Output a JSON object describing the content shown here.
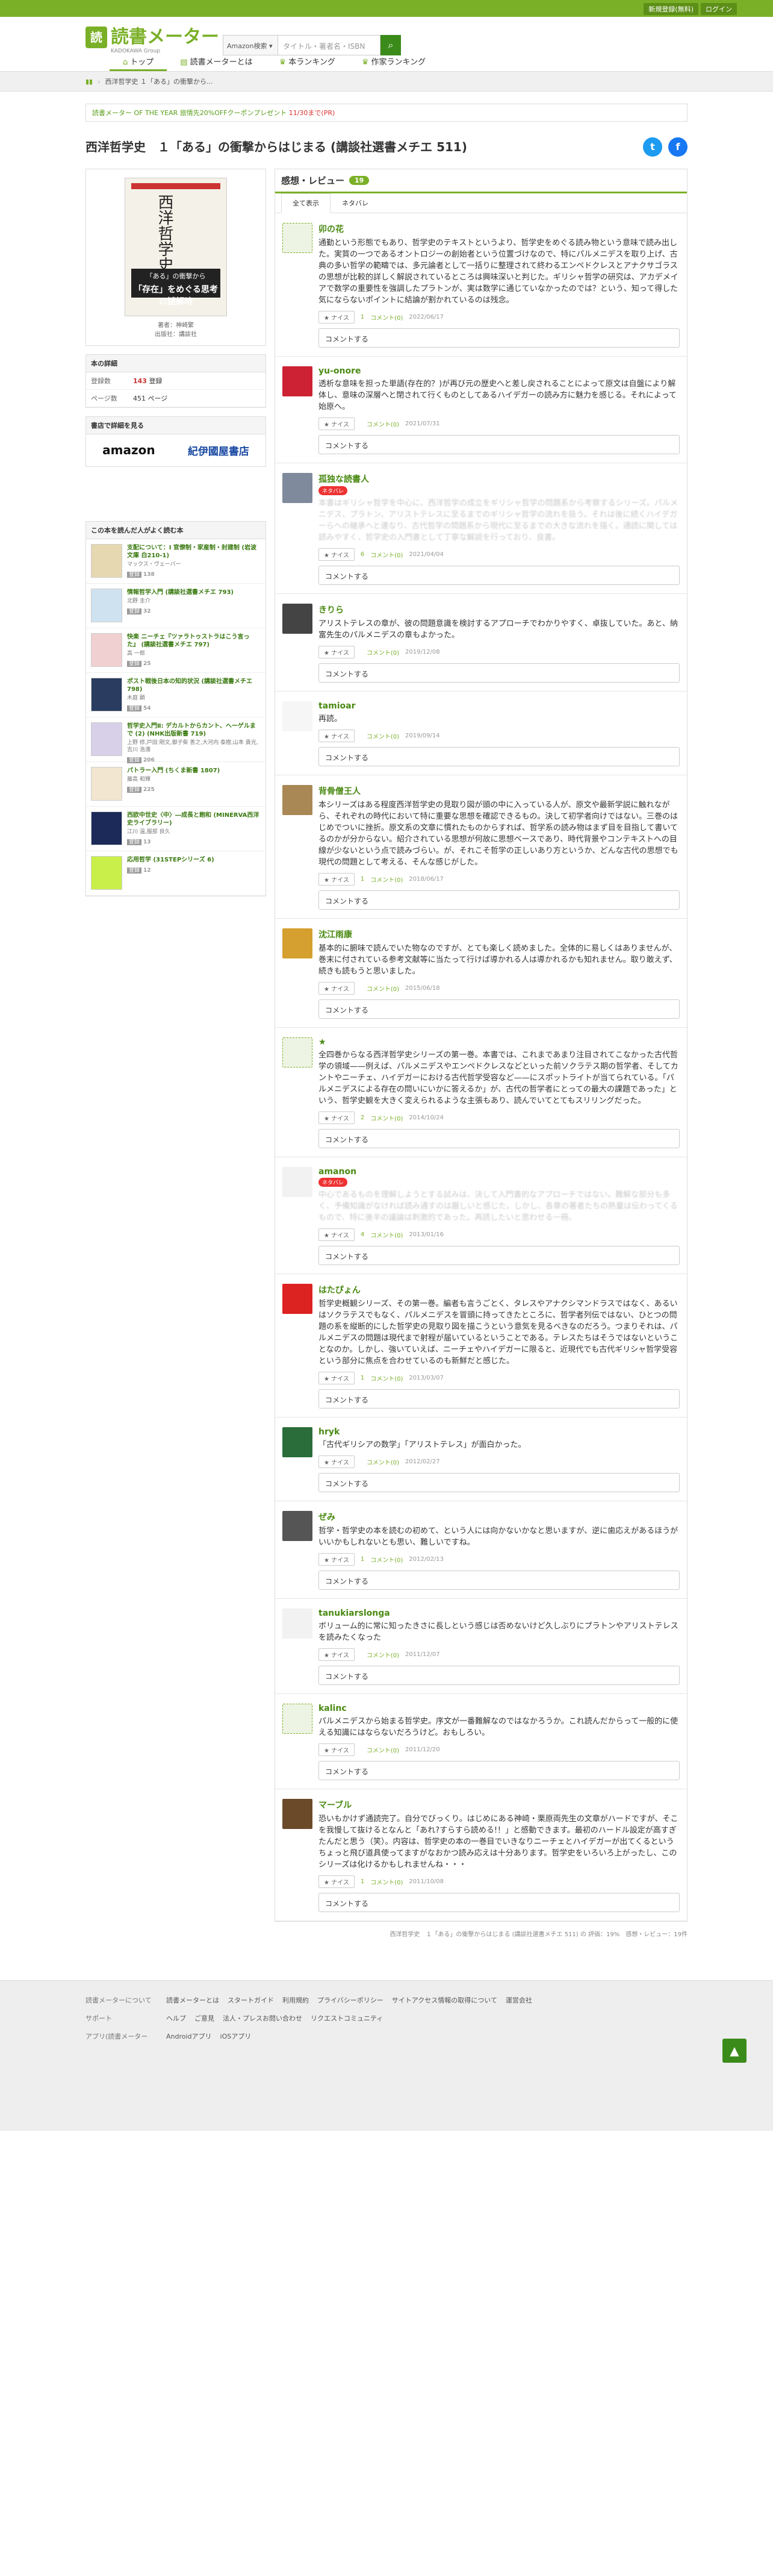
{
  "topbar": {
    "signup": "新規登録(無料)",
    "login": "ログイン"
  },
  "logo": {
    "mark": "読",
    "title": "読書メーター",
    "sub": "KADOKAWA Group"
  },
  "search": {
    "select": "Amazon検索 ▾",
    "placeholder": "タイトル・著者名・ISBN",
    "icon": "search-icon"
  },
  "nav": [
    {
      "icon": "home-icon",
      "label": "トップ"
    },
    {
      "icon": "book-icon",
      "label": "読書メーターとは"
    },
    {
      "icon": "ranking-icon",
      "label": "本ランキング"
    },
    {
      "icon": "author-icon",
      "label": "作家ランキング"
    }
  ],
  "breadcrumb": [
    "西洋哲学史 １「ある」の衝撃から..."
  ],
  "notice": {
    "a": "読書メーター OF THE YEAR",
    "b": "旅情先20%OFFクーポンプレゼント",
    "c": "11/30まで(PR)"
  },
  "title": "西洋哲学史　１「ある」の衝撃からはじまる (講談社選書メチエ 511)",
  "share": {
    "tw": "t",
    "fb": "f"
  },
  "book": {
    "cover_title": "西洋哲学史Ⅰ",
    "band_top": "「ある」の衝撃から",
    "band_main": "「存在」をめぐる思考の謎解時",
    "author": "著者：神崎繁",
    "publisher": "出版社：講談社"
  },
  "details": {
    "header": "本の詳細",
    "rows": [
      {
        "k": "登録数",
        "v": "143",
        "u": "登録"
      },
      {
        "k": "ページ数",
        "v": "451",
        "u": "ページ"
      }
    ]
  },
  "buy": {
    "header": "書店で詳細を見る",
    "amazon": "amazon",
    "kino": "紀伊國屋書店"
  },
  "alsoread": {
    "header": "この本を読んだ人がよく読む本",
    "items": [
      {
        "t": "支配について：Ⅰ 官僚制・家産制・封建制 (岩波文庫 白210-1)",
        "a": "マックス・ヴェーバー",
        "c": "138"
      },
      {
        "t": "情報哲学入門 (講談社選書メチエ 793)",
        "a": "北野 圭介",
        "c": "32"
      },
      {
        "t": "快楽 ニーチェ『ツァラトゥストラはこう言った』 (講談社選書メチエ 797)",
        "a": "高 一郎",
        "c": "25"
      },
      {
        "t": "ポスト戦後日本の知的状況 (講談社選書メチエ 798)",
        "a": "木庭 顕",
        "c": "54"
      },
      {
        "t": "哲学史入門Ⅱ: デカルトからカント、ヘーゲルまで (2) (NHK出版新書 719)",
        "a": "上野 修,戸田 剛文,御子柴 善之,大河内 泰樹,山本 貴光,吉川 浩満",
        "c": "206"
      },
      {
        "t": "パトラー入門 (ちくま新書 1807)",
        "a": "藤高 和輝",
        "c": "225"
      },
      {
        "t": "西欧中世史〈中〉―成長と飽和 (MINERVA西洋史ライブラリー)",
        "a": "江川 溫,服部 良久",
        "c": "13"
      },
      {
        "t": "応用哲学 (31STEPシリーズ 6)",
        "a": "",
        "c": "12"
      }
    ]
  },
  "reviews_header": {
    "title": "感想・レビュー",
    "count": "19",
    "tab_all": "全て表示",
    "tab_spoiler": "ネタバレ"
  },
  "labels": {
    "nice": "★ ナイス",
    "comment_box": "コメントする",
    "spoiler": "ネタバレ"
  },
  "reviews": [
    {
      "user": "卯の花",
      "spoiler": false,
      "text": "通勤という形態でもあり、哲学史のテキストというより、哲学史をめぐる読み物という意味で読み出した。実質の一つであるオントロジーの創始者という位置づけなので、特にパルメニデスを取り上げ、古典の多い哲学の範疇では、多元論者として一括りに整理されて終わるエンペドクレスとアナクサゴラスの思想が比較的詳しく解説されているところは興味深いと判じた。ギリシャ哲学の研究は、アカデメイアで数学の重要性を強調したプラトンが、実は数学に通じていなかったのでは？という、知って得した気にならないポイントに結論が割かれているのは残念。",
      "nice": "1",
      "cmt": "コメント(0)",
      "date": "2022/06/17"
    },
    {
      "user": "yu-onore",
      "spoiler": false,
      "text": "透析な意味を担った単語(存在的？)が再び元の歴史へと差し戻されることによって原文は自盤により解体し、意味の深層へと閉されて行くものとしてあるハイデガーの読み方に魅力を感じる。それによって始原へ。",
      "nice": "",
      "cmt": "コメント(0)",
      "date": "2021/07/31"
    },
    {
      "user": "孤独な読書人",
      "spoiler": true,
      "text": "本書はギリシャ哲学を中心に、西洋哲学の成立をギリシャ哲学の問題系から考察するシリーズ。パルメニデス、プラトン、アリストテレスに至るまでのギリシャ哲学の流れを扱う。それは後に続くハイデガーらへの継承へと連なり、古代哲学の問題系から現代に至るまでの大きな流れを描く。通読に関しては読みやすく、哲学史の入門書として丁寧な解説を行っており、良書。",
      "nice": "6",
      "cmt": "コメント(0)",
      "date": "2021/04/04"
    },
    {
      "user": "きりら",
      "spoiler": false,
      "text": "アリストテレスの章が、彼の問題意識を検討するアプローチでわかりやすく、卓抜していた。あと、納富先生のパルメニデスの章もよかった。",
      "nice": "",
      "cmt": "コメント(0)",
      "date": "2019/12/08"
    },
    {
      "user": "tamioar",
      "spoiler": false,
      "text": "再読。",
      "nice": "",
      "cmt": "コメント(0)",
      "date": "2019/09/14"
    },
    {
      "user": "背骨僧王人",
      "spoiler": false,
      "text": "本シリーズはある程度西洋哲学史の見取り図が頭の中に入っている人が、原文や最新学説に触れながら、それぞれの時代において特に重要な思想を確認できるもの。決して初学者向けではない。三巻のはじめでついに挫折。原文系の文章に慣れたものからすれば、哲学系の読み物はまず目を目指して書いてるのかが分からない。紹介されている思想が何故に思想ベースであり、時代背景やコンテキストへの目線が少ないという点で読みづらい。が、それこそ哲学の正しいあり方というか、どんな古代の思想でも現代の問題として考える、そんな感じがした。",
      "nice": "1",
      "cmt": "コメント(0)",
      "date": "2018/06/17"
    },
    {
      "user": "沈江雨康",
      "spoiler": false,
      "text": "基本的に腑味で読んでいた物なのですが、とても楽しく読めました。全体的に易しくはありませんが、巻末に付されている参考文献等に当たって行けば導かれる人は導かれるかも知れません。取り敢えず、続きも読もうと思いました。",
      "nice": "",
      "cmt": "コメント(0)",
      "date": "2015/06/18"
    },
    {
      "user": "★",
      "spoiler": false,
      "text": "全四巻からなる西洋哲学史シリーズの第一巻。本書では、これまであまり注目されてこなかった古代哲学の領域——例えば、パルメニデスやエンペドクレスなどといった前ソクラテス期の哲学者、そしてカントやニーチェ、ハイデガーにおける古代哲学受容など——にスポットライトが当てられている。「パルメニデスによる存在の問いにいかに答えるか」が、古代の哲学者にとっての最大の課題であった」という、哲学史観を大きく変えられるような主張もあり、読んでいてとてもスリリングだった。",
      "nice": "2",
      "cmt": "コメント(0)",
      "date": "2014/10/24"
    },
    {
      "user": "amanon",
      "spoiler": true,
      "text": "中心であるものを理解しようとする試みは、決して入門書的なアプローチではない。難解な部分も多く、予備知識がなければ読み通すのは厳しいと感じた。しかし、各章の著者たちの熱量は伝わってくるもので、特に後半の議論は刺激的であった。再読したいと思わせる一冊。",
      "nice": "4",
      "cmt": "コメント(0)",
      "date": "2013/01/16"
    },
    {
      "user": "はたぴょん",
      "spoiler": false,
      "text": "哲学史概観シリーズ、その第一巻。編者も言うごとく、タレスやアナクシマンドラスではなく、あるいはソクラテスでもなく、パルメニデスを冒頭に持ってきたところに、哲学者列伝ではない、ひとつの問題の系を縦断的にした哲学史の見取り図を描こうという意気を見るべきなのだろう。つまりそれは、パルメニデスの問題は現代まで射程が届いているということである。テレスたちはそうではないということなのか。しかし、強いていえば、ニーチェやハイデガーに限ると、近現代でも古代ギリシャ哲学受容という部分に焦点を合わせているのも新鮮だと感じた。",
      "nice": "1",
      "cmt": "コメント(0)",
      "date": "2013/03/07"
    },
    {
      "user": "hryk",
      "spoiler": false,
      "text": "「古代ギリシアの数学」「アリストテレス」が面白かった。",
      "nice": "",
      "cmt": "コメント(0)",
      "date": "2012/02/27"
    },
    {
      "user": "ぜみ",
      "spoiler": false,
      "text": "哲学・哲学史の本を読むの初めて、という人には向かないかなと思いますが、逆に歯応えがあるほうがいいかもしれないとも思い、難しいですね。",
      "nice": "1",
      "cmt": "コメント(0)",
      "date": "2012/02/13"
    },
    {
      "user": "tanukiarslonga",
      "spoiler": false,
      "text": "ボリューム的に常に知ったきさに長しという感じは否めないけど久しぶりにプラトンやアリストテレスを読みたくなった",
      "nice": "",
      "cmt": "コメント(0)",
      "date": "2011/12/07"
    },
    {
      "user": "kalinc",
      "spoiler": false,
      "text": "パルメニデスから始まる哲学史。序文が一番難解なのではなかろうか。これ読んだからって一般的に使える知識にはならないだろうけど。おもしろい。",
      "nice": "",
      "cmt": "コメント(0)",
      "date": "2011/12/20"
    },
    {
      "user": "マーブル",
      "spoiler": false,
      "text": "恐いもかけず通読完了。自分でびっくり。はじめにある神崎・栗原両先生の文章がハードですが、そこを我慢して抜けるとなんと「あれ?すらすら読める!！」と感動できます。最初のハードル設定が高すぎたんだと思う（笑）。内容は、哲学史の本の一巻目でいきなりニーチェとハイデガーが出てくるというちょっと飛び道具使ってますがなおかつ読み応えは十分あります。哲学史をいろいろ上がったし、このシリーズは化けるかもしれませんね・・・",
      "nice": "1",
      "cmt": "コメント(0)",
      "date": "2011/10/08"
    }
  ],
  "footnote": "西洋哲学史　１「ある」の衝撃からはじまる (講談社選書メチエ 511) の 評価：19%　感想・レビュー：19件",
  "footer": {
    "rows": [
      {
        "h": "読書メーターについて",
        "links": [
          "読書メーターとは",
          "スタートガイド",
          "利用規約",
          "プライバシーポリシー",
          "サイトアクセス情報の取得について",
          "運営会社"
        ]
      },
      {
        "h": "サポート",
        "links": [
          "ヘルプ",
          "ご意見",
          "法人・プレスお問い合わせ",
          "リクエストコミュニティ"
        ]
      },
      {
        "h": "アプリ(読書メーター",
        "links": [
          "Androidアプリ",
          "iOSアプリ"
        ]
      }
    ],
    "top": "▲"
  }
}
